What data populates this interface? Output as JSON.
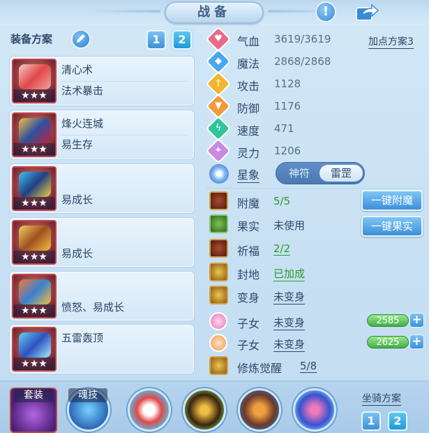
{
  "header": {
    "title": "战备"
  },
  "equipment": {
    "plan_label": "装备方案",
    "plan_buttons": [
      "1",
      "2"
    ],
    "items": [
      {
        "line1": "清心术",
        "line2": "法术暴击",
        "stars": "★★★"
      },
      {
        "line1": "烽火连城",
        "line2": "易生存",
        "stars": "★★★"
      },
      {
        "line1": "",
        "line2": "易成长",
        "stars": "★★★"
      },
      {
        "line1": "",
        "line2": "易成长",
        "stars": "★★★"
      },
      {
        "line1": "",
        "line2": "愤怒、易成长",
        "stars": "★★★"
      },
      {
        "line1": "五雷轰顶",
        "line2": "",
        "stars": "★★★"
      }
    ]
  },
  "attributes": {
    "plan_link": "加点方案3",
    "rows": [
      {
        "name": "气血",
        "value": "3619/3619",
        "color": "#e86a8c",
        "glyph": "♥"
      },
      {
        "name": "魔法",
        "value": "2868/2868",
        "color": "#4aa6f0",
        "glyph": "◆"
      },
      {
        "name": "攻击",
        "value": "1128",
        "color": "#f3b530",
        "glyph": "†"
      },
      {
        "name": "防御",
        "value": "1176",
        "color": "#f39a3c",
        "glyph": "▼"
      },
      {
        "name": "速度",
        "value": "471",
        "color": "#2fc59a",
        "glyph": "ϟ"
      },
      {
        "name": "灵力",
        "value": "1206",
        "color": "#c98ae6",
        "glyph": "✦"
      }
    ]
  },
  "constellation": {
    "label": "星象",
    "options": [
      "神符",
      "雷罡"
    ],
    "selected": "雷罡"
  },
  "actions": [
    {
      "name": "附魔",
      "value": "5/5",
      "style": "green",
      "button": "一键附魔"
    },
    {
      "name": "果实",
      "value": "未使用",
      "style": "plain",
      "button": "一键果实"
    },
    {
      "name": "祈福",
      "value": "2/2",
      "style": "green",
      "button": ""
    },
    {
      "name": "封地",
      "value": "已加成",
      "style": "green",
      "button": ""
    },
    {
      "name": "变身",
      "value": "未变身",
      "style": "plain-u",
      "button": ""
    }
  ],
  "children": [
    {
      "name": "子女",
      "value": "未变身",
      "bar": "2585",
      "color": "#e874b8"
    },
    {
      "name": "子女",
      "value": "未变身",
      "bar": "2625",
      "color": "#f2964a"
    }
  ],
  "cultivation": {
    "name": "修炼觉醒",
    "value": "5/8"
  },
  "bottom": {
    "set_label": "套装",
    "soul_label": "魂技",
    "mount_label": "坐骑方案",
    "mount_buttons": [
      "1",
      "2"
    ]
  }
}
